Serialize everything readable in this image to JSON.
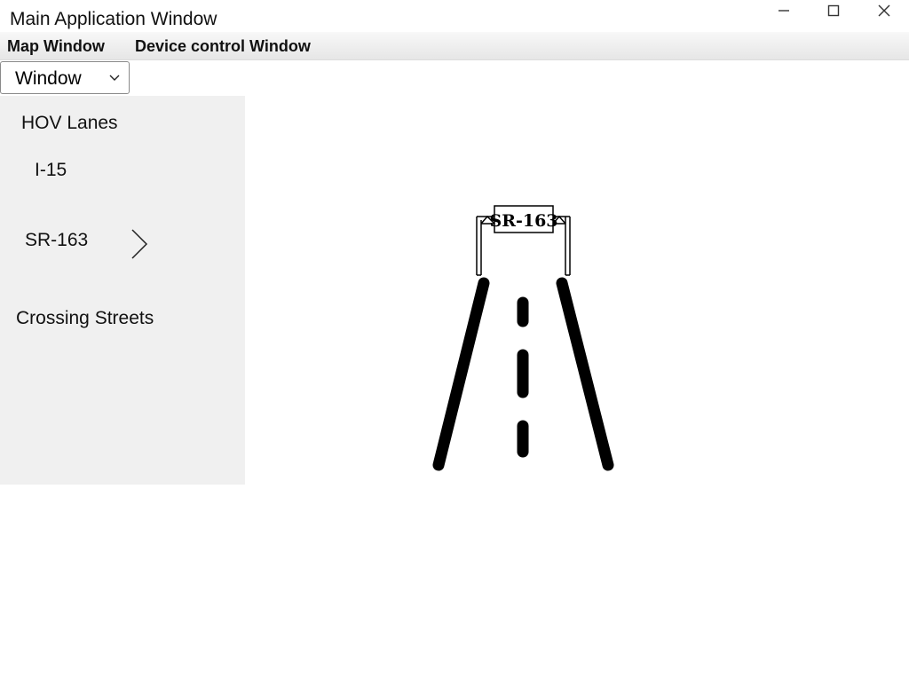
{
  "window": {
    "title": "Main Application Window",
    "controls": {
      "minimize": "minimize-icon",
      "maximize": "maximize-icon",
      "close": "close-icon"
    }
  },
  "menu": {
    "items": [
      {
        "label": "Map Window"
      },
      {
        "label": "Device control Window"
      }
    ]
  },
  "window_select": {
    "value": "Window",
    "icon": "chevron-down-icon"
  },
  "sidebar": {
    "items": [
      {
        "label": "HOV Lanes"
      },
      {
        "label": "I-15"
      },
      {
        "label": "SR-163",
        "icon": "chevron-right-icon"
      },
      {
        "label": "Crossing Streets"
      }
    ]
  },
  "map": {
    "sign_text": "SR-163",
    "icon": "highway-road-icon"
  },
  "colors": {
    "sidebar_bg": "#f0f0f0",
    "menubar_bg": "#ececec",
    "road": "#000000"
  }
}
